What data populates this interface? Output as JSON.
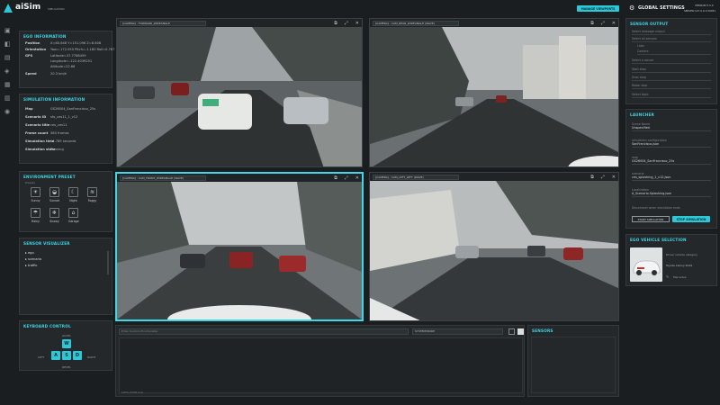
{
  "app": {
    "logo": "aiSim",
    "subtitle": "SIMULATION",
    "manage_btn": "MANAGE VIEWPORTS",
    "global_settings": "GLOBAL SETTINGS",
    "version": "VERSION 5.5.0",
    "server": "SERVER:",
    "server_value": "127.0.0.1:50051"
  },
  "ego": {
    "title": "EGO INFORMATION",
    "rows": [
      {
        "k": "Position",
        "v": "X=60.648 Y=151.096 Z=8.608"
      },
      {
        "k": "Orientation",
        "v": "Yaw=-172.050 Pitch=-1.180 Roll=0.787"
      },
      {
        "k": "GPS",
        "v": "Latitude=37.7768459"
      },
      {
        "k": "",
        "v": "Longitude=-122.4039251"
      },
      {
        "k": "",
        "v": "Altitude=22.66"
      },
      {
        "k": "Speed",
        "v": "20.3 km/h"
      }
    ]
  },
  "sim": {
    "title": "SIMULATION INFORMATION",
    "rows": [
      {
        "k": "Map",
        "v": "GS26004_SanFrancisco_25s"
      },
      {
        "k": "Scenario ID",
        "v": "sfo_ces11_1_v12"
      },
      {
        "k": "Scenario title",
        "v": "ces_ces11"
      },
      {
        "k": "Frame count",
        "v": "580 frames"
      },
      {
        "k": "Simulation time",
        "v": "14.789 seconds"
      },
      {
        "k": "Simulation state",
        "v": "Running"
      }
    ]
  },
  "env": {
    "title": "ENVIRONMENT PRESET",
    "preset": "Presets",
    "row1": [
      "Sunny",
      "Sunset",
      "Night",
      "Foggy"
    ],
    "row2": [
      "Rainy",
      "Snowy",
      "Garage"
    ],
    "icons1": [
      "sun-icon",
      "sunset-icon",
      "moon-icon",
      "fog-icon"
    ],
    "icons2": [
      "rain-icon",
      "snow-icon",
      "garage-icon"
    ]
  },
  "sensor_viz": {
    "title": "SENSOR VISUALIZER",
    "items": [
      "ego",
      "scenario",
      "traffic"
    ]
  },
  "keyboard": {
    "title": "KEYBOARD CONTROL",
    "accel": "ACCEL",
    "decel": "DECEL",
    "left": "LEFT",
    "right": "RIGHT",
    "up": "W",
    "k_a": "A",
    "k_s": "S",
    "k_d": "D"
  },
  "cameras": [
    {
      "label": "[CAMERA] : FORWARD_WIDEANGLE"
    },
    {
      "label": "[CAMERA] : CAM_REAR_WIDEANGLE (WAVE)"
    },
    {
      "label": "[CAMERA] : CAM_FRONT_WIDEANGLE (WAVE)"
    },
    {
      "label": "[CAMERA] : CAM_LEFT_LEFT (WAVE)"
    }
  ],
  "console": {
    "placeholder": "Enter Custom Env/Variable",
    "select": "SYSTEM/MODE",
    "footer": "SIMULATION LOG"
  },
  "sensors_panel": {
    "title": "SENSORS"
  },
  "sensor_output": {
    "title": "SENSOR OUTPUT",
    "items": [
      "Select message output",
      "Select all sensors",
      "Lidar",
      "Camera",
      "Select a sensor",
      "Start step",
      "Gnss step",
      "Radar step",
      "Select topic"
    ]
  },
  "launcher": {
    "title": "LAUNCHER",
    "scene_label": "Scene Name",
    "scene_value": "Unspecified",
    "conf_label": "simulation configuration",
    "conf_value": "SanFrancisco.json",
    "map_label": "map",
    "map_value": "GS26004_SanFrancisco_25s",
    "scenario_label": "scenario",
    "scenario_value": "ces_splashing_1_v12.json",
    "loc_label": "Localization",
    "loc_value": "A_Scenario.Splashing.json",
    "toggle": "Disconnect when simulation ends",
    "start": "START SIMULATION",
    "stop": "STOP SIMULATION"
  },
  "ego_sel": {
    "title": "EGO VEHICLE SELECTION",
    "line1": "Driver vehicle category",
    "line2": "Toyota Camry 2019",
    "line3": "Mercedes"
  }
}
